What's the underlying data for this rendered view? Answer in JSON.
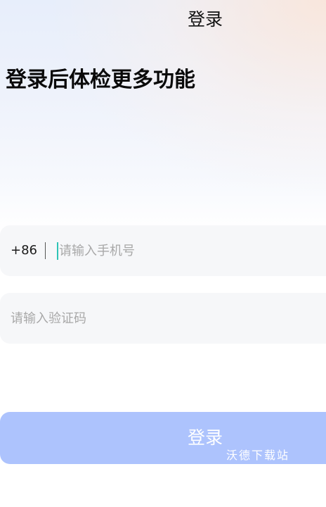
{
  "header": {
    "title": "登录"
  },
  "main": {
    "headline": "登录后体检更多功能"
  },
  "phone_field": {
    "country_code": "+86",
    "placeholder": "请输入手机号",
    "value": ""
  },
  "code_field": {
    "placeholder": "请输入验证码",
    "value": ""
  },
  "login_button": {
    "label": "登录"
  },
  "watermark": {
    "text": "沃德下载站"
  },
  "colors": {
    "button_background": "#adc3fd",
    "field_background": "#f6f7f9",
    "cursor": "#2ec4b6"
  }
}
